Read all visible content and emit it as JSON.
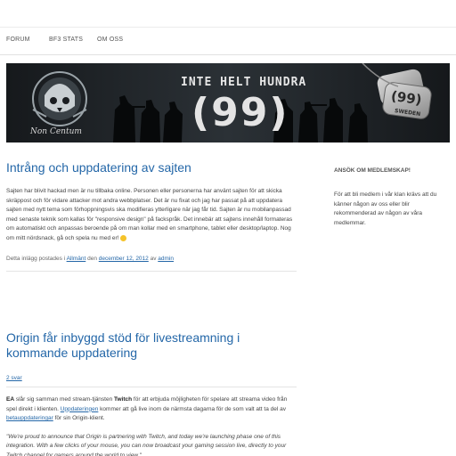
{
  "nav": {
    "items": [
      {
        "label": "FORUM"
      },
      {
        "label": "BF3 STATS"
      },
      {
        "label": "OM OSS"
      }
    ]
  },
  "banner": {
    "title": "INTE HELT HUNDRA",
    "number": "(99)",
    "motto": "Non Centum",
    "tag_number": "(99)",
    "tag_country": "SWEDEN"
  },
  "post1": {
    "title": "Intrång och uppdatering av sajten",
    "body": [
      "Sajten har blivit hackad men är nu tillbaka online. Personen eller personerna har använt sajten för",
      "att skicka skräppost och för vidare attacker mot andra webbplatser. Det är nu fixat och jag har",
      "passat på att uppdatera sajten med nytt tema som förhoppningsvis ska modifieras ytterligare när",
      "jag får tid. Sajten är nu mobilanpassad med senaste teknik som kallas för \"responsive design\" på",
      "fackspråk. Det innebär att sajtens innehåll formateras om automatiskt och anpassas beroende på",
      "om man kollar med en smartphone, tablet eller desktop/laptop. Nog om mitt nördsnack, gå och",
      "spela nu med er!"
    ],
    "meta_prefix": "Detta inlägg postades i",
    "meta_category": "Allmänt",
    "meta_date_prefix": "den",
    "meta_date": "december 12, 2012",
    "meta_author_prefix": "av",
    "meta_author": "admin"
  },
  "post2": {
    "title": "Origin får inbyggd stöd för livestreamning i kommande uppdatering",
    "comments": "2 svar",
    "p1_brand": "EA",
    "p1_a": " slår sig samman med stream-tjänsten ",
    "p1_twitch": "Twitch",
    "p1_b": " för att erbjuda möjligheten för spelare att streama video från spel direkt i klienten. ",
    "p1_link1": "Uppdateringen",
    "p1_c": " kommer att gå live inom de närmsta dagarna för de som valt att ta del av ",
    "p1_link2": "betauppdateringar",
    "p1_d": " för sin Origin-klient.",
    "quote": "\"We're proud to announce that Origin is partnering with Twitch, and today we're launching phase one of this integration. With a few clicks of your mouse, you can now broadcast your gaming session live, directly to your Twitch channel for gamers around the world to view.\""
  },
  "sidebar": {
    "heading": "ANSÖK OM MEDLEMSKAP!",
    "text": "För att bli medlem i vår klan krävs att du känner någon av oss eller blir rekommenderad av någon av våra medlemmar."
  }
}
